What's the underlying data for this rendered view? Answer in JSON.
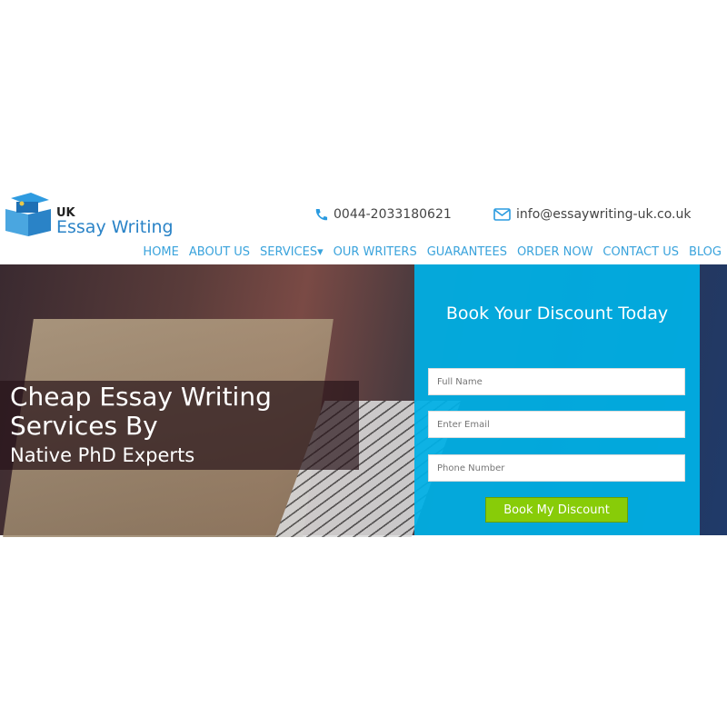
{
  "logo": {
    "line1": "UK",
    "line2": "Essay Writing"
  },
  "header": {
    "phone": "0044-2033180621",
    "email": "info@essaywriting-uk.co.uk",
    "icons": {
      "phone": "phone-icon",
      "email": "envelope-icon"
    }
  },
  "nav": {
    "items": [
      "HOME",
      "ABOUT US",
      "SERVICES▾",
      "OUR WRITERS",
      "GUARANTEES",
      "ORDER NOW",
      "CONTACT US",
      "BLOG"
    ]
  },
  "hero": {
    "headline": "Cheap Essay Writing Services By",
    "subheadline": "Native PhD Experts"
  },
  "form": {
    "title": "Book Your Discount Today",
    "name_placeholder": "Full Name",
    "email_placeholder": "Enter Email",
    "phone_placeholder": "Phone Number",
    "submit_label": "Book My Discount"
  },
  "colors": {
    "brand": "#2a83c7",
    "nav": "#3aa3dc",
    "form_bg": "#00b0e6",
    "button": "#88cc08"
  }
}
